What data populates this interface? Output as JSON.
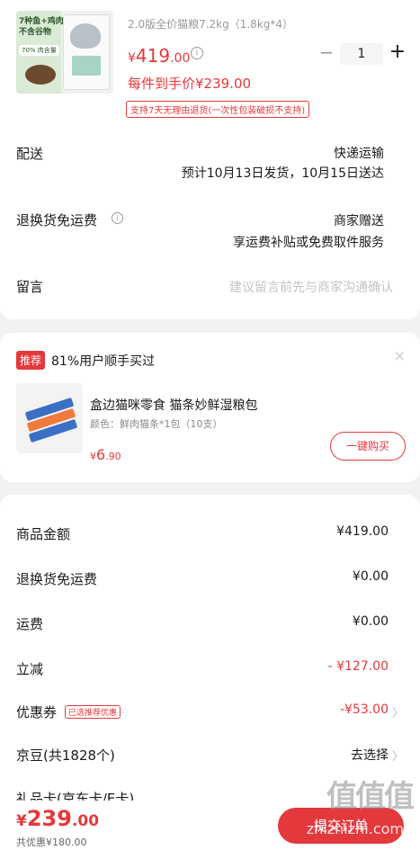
{
  "product": {
    "image_text": [
      "7种鱼+鸡肉",
      "不含谷物"
    ],
    "image_tag": "70% 肉含量",
    "spec": "2.0版全价猫粮7.2kg（1.8kg*4）",
    "price_yen": "¥",
    "price_int": "419",
    "price_dec": ".00",
    "hand_price": "每件到手价¥239.00",
    "return_tag": "支持7天无理由退货(一次性包装破损不支持)",
    "quantity": "1",
    "minus": "−",
    "plus": "+"
  },
  "delivery": {
    "label": "配送",
    "method": "快递运输",
    "schedule": "预计10月13日发货，10月15日送达"
  },
  "return_freight": {
    "label": "退换货免运费",
    "value": "商家赠送",
    "desc": "享运费补贴或免费取件服务"
  },
  "message": {
    "label": "留言",
    "placeholder": "建议留言前先与商家沟通确认"
  },
  "recommend": {
    "badge": "推荐",
    "title": "81%用户顺手买过",
    "close": "×",
    "item_name": "盒边猫咪零食 猫条妙鲜湿粮包",
    "item_spec": "颜色：鲜肉猫条*1包（10支）",
    "price_yen": "¥",
    "price_int": "6",
    "price_dec": ".90",
    "buy_button": "一键购买"
  },
  "summary": {
    "rows": [
      {
        "label": "商品金额",
        "value": "¥419.00"
      },
      {
        "label": "退换货免运费",
        "value": "¥0.00"
      },
      {
        "label": "运费",
        "value": "¥0.00"
      },
      {
        "label": "立减",
        "value": "- ¥127.00"
      },
      {
        "label": "优惠券",
        "tag": "已选推荐优惠",
        "value": "-¥53.00"
      },
      {
        "label": "京豆(共1828个)",
        "value": "去选择"
      },
      {
        "label": "礼品卡(京东卡/E卡)",
        "value": ""
      }
    ]
  },
  "bottom": {
    "total_yen": "¥",
    "total_int": "239",
    "total_dec": ".00",
    "saved": "共优惠¥180.00",
    "submit": "提交订单"
  },
  "watermark": {
    "text": "值值值",
    "url": "zhizhizhi.com"
  },
  "colors": {
    "accent": "#e4393c",
    "background": "#f2f2f2"
  }
}
